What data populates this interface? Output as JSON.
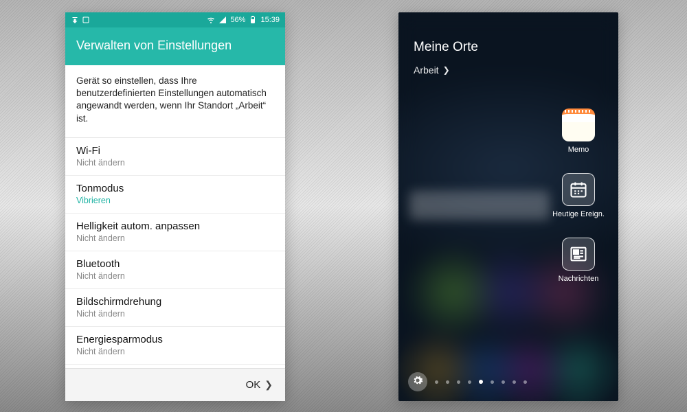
{
  "left": {
    "statusbar": {
      "battery_text": "56%",
      "time": "15:39"
    },
    "title": "Verwalten von Einstellungen",
    "description": "Gerät so einstellen, dass Ihre benutzerdefinierten Einstellungen automatisch angewandt werden, wenn Ihr Standort „Arbeit“ ist.",
    "settings": [
      {
        "label": "Wi-Fi",
        "value": "Nicht ändern",
        "accent": false
      },
      {
        "label": "Tonmodus",
        "value": "Vibrieren",
        "accent": true
      },
      {
        "label": "Helligkeit autom. anpassen",
        "value": "Nicht ändern",
        "accent": false
      },
      {
        "label": "Bluetooth",
        "value": "Nicht ändern",
        "accent": false
      },
      {
        "label": "Bildschirmdrehung",
        "value": "Nicht ändern",
        "accent": false
      },
      {
        "label": "Energiesparmodus",
        "value": "Nicht ändern",
        "accent": false
      }
    ],
    "ok_label": "OK"
  },
  "right": {
    "title": "Meine Orte",
    "subtitle": "Arbeit",
    "items": [
      {
        "label": "Memo"
      },
      {
        "label": "Heutige Ereign."
      },
      {
        "label": "Nachrichten"
      }
    ],
    "page_count": 9,
    "active_page": 4
  }
}
